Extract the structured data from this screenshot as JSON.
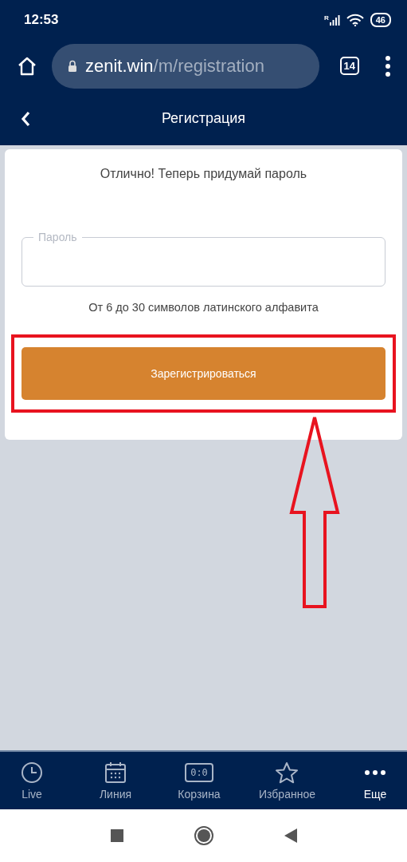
{
  "status_bar": {
    "time": "12:53",
    "network": "R",
    "battery": "46"
  },
  "browser": {
    "url_host": "zenit.win",
    "url_path": "/m/registration",
    "tab_count": "14"
  },
  "header": {
    "title": "Регистрация"
  },
  "form": {
    "heading": "Отлично! Теперь придумай пароль",
    "password_field": {
      "placeholder": "Пароль"
    },
    "hint": "От 6 до 30 символов латинского алфавита",
    "submit": "Зарегистрироваться"
  },
  "bottom_nav": [
    {
      "kind": "clock",
      "label": "Live",
      "selected": false
    },
    {
      "kind": "calendar",
      "label": "Линия",
      "selected": false
    },
    {
      "kind": "score",
      "label": "Корзина",
      "icon_text": "0:0",
      "selected": false
    },
    {
      "kind": "star",
      "label": "Избранное",
      "selected": false
    },
    {
      "kind": "dots",
      "label": "Еще",
      "selected": true
    }
  ]
}
